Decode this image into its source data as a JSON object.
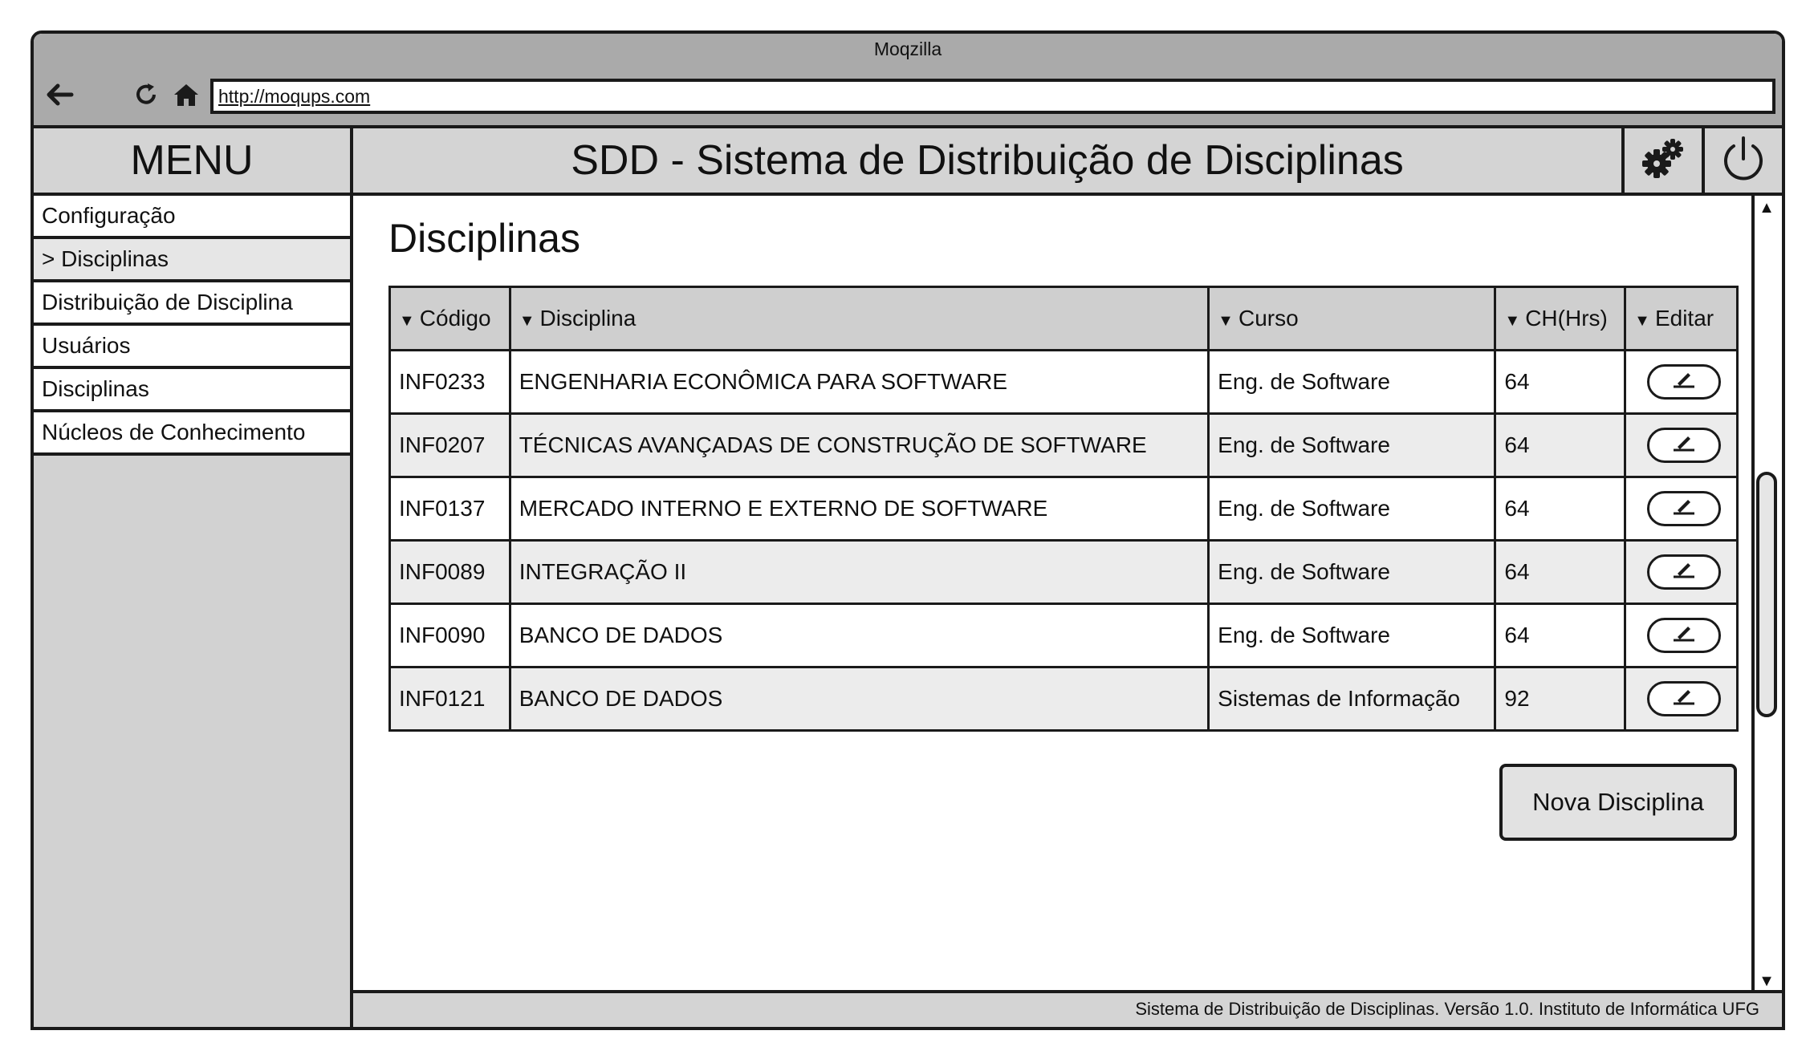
{
  "browser": {
    "title": "Moqzilla",
    "url": "http://moqups.com"
  },
  "menu": {
    "title": "MENU",
    "items": [
      {
        "label": "Configuração"
      },
      {
        "label": "> Disciplinas"
      },
      {
        "label": "Distribuição de Disciplina"
      },
      {
        "label": "Usuários"
      },
      {
        "label": "Disciplinas"
      },
      {
        "label": "Núcleos de Conhecimento"
      }
    ]
  },
  "header": {
    "title": "SDD - Sistema de Distribuição de Disciplinas",
    "settings_icon": "gear-icon",
    "power_icon": "power-icon"
  },
  "main": {
    "title": "Disciplinas",
    "table": {
      "columns": [
        "Código",
        "Disciplina",
        "Curso",
        "CH(Hrs)",
        "Editar"
      ],
      "rows": [
        [
          "INF0233",
          "ENGENHARIA ECONÔMICA PARA SOFTWARE",
          "Eng. de Software",
          "64"
        ],
        [
          "INF0207",
          "TÉCNICAS AVANÇADAS DE CONSTRUÇÃO DE SOFTWARE",
          "Eng. de Software",
          "64"
        ],
        [
          "INF0137",
          "MERCADO INTERNO E EXTERNO DE SOFTWARE",
          "Eng. de Software",
          "64"
        ],
        [
          "INF0089",
          "INTEGRAÇÃO II",
          "Eng. de Software",
          "64"
        ],
        [
          "INF0090",
          "BANCO DE DADOS",
          "Eng. de Software",
          "64"
        ],
        [
          "INF0121",
          "BANCO DE DADOS",
          "Sistemas de Informação",
          "92"
        ]
      ]
    },
    "new_button": "Nova Disciplina"
  },
  "footer": {
    "text": "Sistema de Distribuição de Disciplinas. Versão 1.0. Instituto de Informática UFG"
  }
}
